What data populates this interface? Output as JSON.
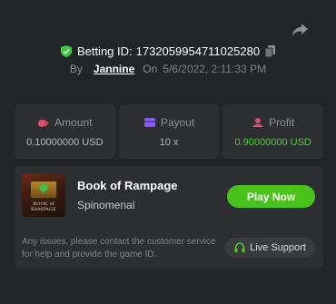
{
  "header": {
    "share_icon": "share-arrow-icon",
    "betting_id_label": "Betting ID:",
    "betting_id": "1732059954711025280",
    "verified_icon": "shield-check-icon",
    "copy_icon": "copy-icon",
    "by_label": "By",
    "username": "Jannine",
    "on_label": "On",
    "date": "5/6/2022, 2:11:33 PM"
  },
  "stats": [
    {
      "label": "Amount",
      "value": "0.10000000 USD",
      "icon": "coins-icon"
    },
    {
      "label": "Payout",
      "value": "10 x",
      "icon": "wallet-icon"
    },
    {
      "label": "Profit",
      "value": "0.90000000 USD",
      "icon": "profit-icon"
    }
  ],
  "game": {
    "title": "Book of Rampage",
    "provider": "Spinomenal",
    "thumbnail_text": "BOOK of RAMPAGE",
    "play_label": "Play Now"
  },
  "support": {
    "text": "Any issues, please contact the customer service for help and provide the game ID.",
    "button_label": "Live Support",
    "icon": "headphones-icon"
  },
  "colors": {
    "background": "#232426",
    "panel": "#2d2e31",
    "accent_green": "#49c21c",
    "profit_green": "#4ad12a",
    "amount_icon": "#e0506e",
    "payout_icon": "#8a5cf0",
    "profit_icon": "#e0506e",
    "verified": "#3cc83c"
  }
}
